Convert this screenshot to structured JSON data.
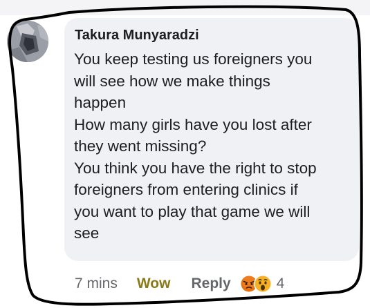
{
  "comment": {
    "author": "Takura Munyaradzi",
    "lines": [
      "You keep testing us foreigners you",
      "will see how we make things",
      "happen",
      "How many girls have you lost after",
      "they went missing?",
      "You think you have the right to stop",
      "foreigners from entering clinics if",
      "you want to play that game we will",
      "see"
    ]
  },
  "footer": {
    "timestamp": "7 mins",
    "reaction_label": "Wow",
    "reply_label": "Reply",
    "reaction_icons": [
      "angry-emoji-icon",
      "wow-emoji-icon"
    ],
    "reaction_count": "4"
  },
  "colors": {
    "bubble": "#f0f1f4",
    "text": "#1c1e21",
    "meta": "#65676b",
    "wow_label": "#8a7a16",
    "marker": "#000000",
    "angry_reaction": "#e9710f",
    "wow_reaction": "#f7b125"
  }
}
